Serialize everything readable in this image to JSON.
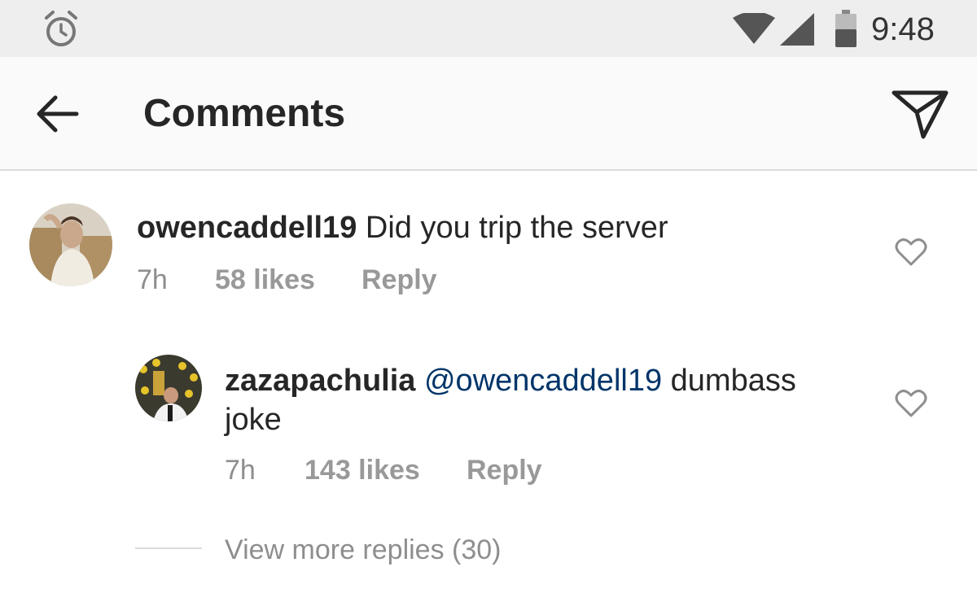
{
  "status_bar": {
    "time": "9:48",
    "icons": [
      "alarm-icon",
      "wifi-icon",
      "cell-signal-icon",
      "battery-icon"
    ]
  },
  "header": {
    "title": "Comments",
    "icons": [
      "back-arrow-icon",
      "send-icon"
    ]
  },
  "comments": [
    {
      "username": "owencaddell19",
      "text": "Did you trip the server",
      "time": "7h",
      "likes": "58 likes",
      "reply": "Reply"
    }
  ],
  "replies": [
    {
      "username": "zazapachulia",
      "mention": "@owencaddell19",
      "text_line1": "dumbass",
      "text_line2": "joke",
      "time": "7h",
      "likes": "143 likes",
      "reply": "Reply"
    }
  ],
  "view_more": "View more replies (30)",
  "colors": {
    "text": "#262626",
    "muted": "#8e8e8e",
    "mention": "#003569",
    "divider": "#dbdbdb",
    "status_bar_bg": "#eeeeee",
    "header_bg": "#fafafa"
  }
}
